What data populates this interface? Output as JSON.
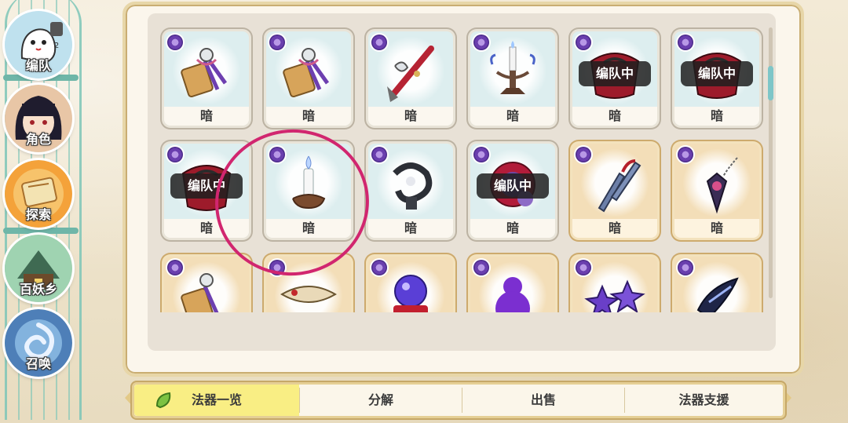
{
  "nav": {
    "items": [
      {
        "label": "编队",
        "icon": "team-icon"
      },
      {
        "label": "角色",
        "icon": "character-icon"
      },
      {
        "label": "探索",
        "icon": "explore-icon"
      },
      {
        "label": "百妖乡",
        "icon": "village-icon"
      },
      {
        "label": "召唤",
        "icon": "summon-icon"
      }
    ]
  },
  "grid": {
    "rows": [
      [
        {
          "element": "暗",
          "status": "",
          "icon": "tag-charm-icon"
        },
        {
          "element": "暗",
          "status": "",
          "icon": "tag-charm-icon"
        },
        {
          "element": "暗",
          "status": "",
          "icon": "red-spear-icon"
        },
        {
          "element": "暗",
          "status": "",
          "icon": "candelabra-icon"
        },
        {
          "element": "暗",
          "status": "编队中",
          "icon": "crimson-cloak-icon"
        },
        {
          "element": "暗",
          "status": "编队中",
          "icon": "crimson-cloak-icon"
        }
      ],
      [
        {
          "element": "暗",
          "status": "编队中",
          "icon": "crimson-cloak-icon"
        },
        {
          "element": "暗",
          "status": "",
          "icon": "candle-icon"
        },
        {
          "element": "暗",
          "status": "",
          "icon": "chain-icon"
        },
        {
          "element": "暗",
          "status": "编队中",
          "icon": "magic-orb-icon"
        },
        {
          "element": "暗",
          "status": "",
          "icon": "kunai-icon"
        },
        {
          "element": "暗",
          "status": "",
          "icon": "pendulum-icon"
        }
      ],
      [
        {
          "element": "",
          "status": "",
          "icon": "tag-charm-icon"
        },
        {
          "element": "",
          "status": "",
          "icon": "fish-skull-icon"
        },
        {
          "element": "",
          "status": "",
          "icon": "crystal-ball-icon"
        },
        {
          "element": "",
          "status": "",
          "icon": "purple-gourd-icon"
        },
        {
          "element": "",
          "status": "",
          "icon": "star-crystals-icon"
        },
        {
          "element": "",
          "status": "",
          "icon": "dark-blade-icon"
        }
      ]
    ]
  },
  "tabs": [
    {
      "label": "法器一览",
      "active": true
    },
    {
      "label": "分解",
      "active": false
    },
    {
      "label": "出售",
      "active": false
    },
    {
      "label": "法器支援",
      "active": false
    }
  ],
  "colors": {
    "highlight_circle": "#d1266f",
    "active_tab": "#f9ee84",
    "cool_card": "#ddeeef",
    "warm_card": "#f3deb8"
  }
}
